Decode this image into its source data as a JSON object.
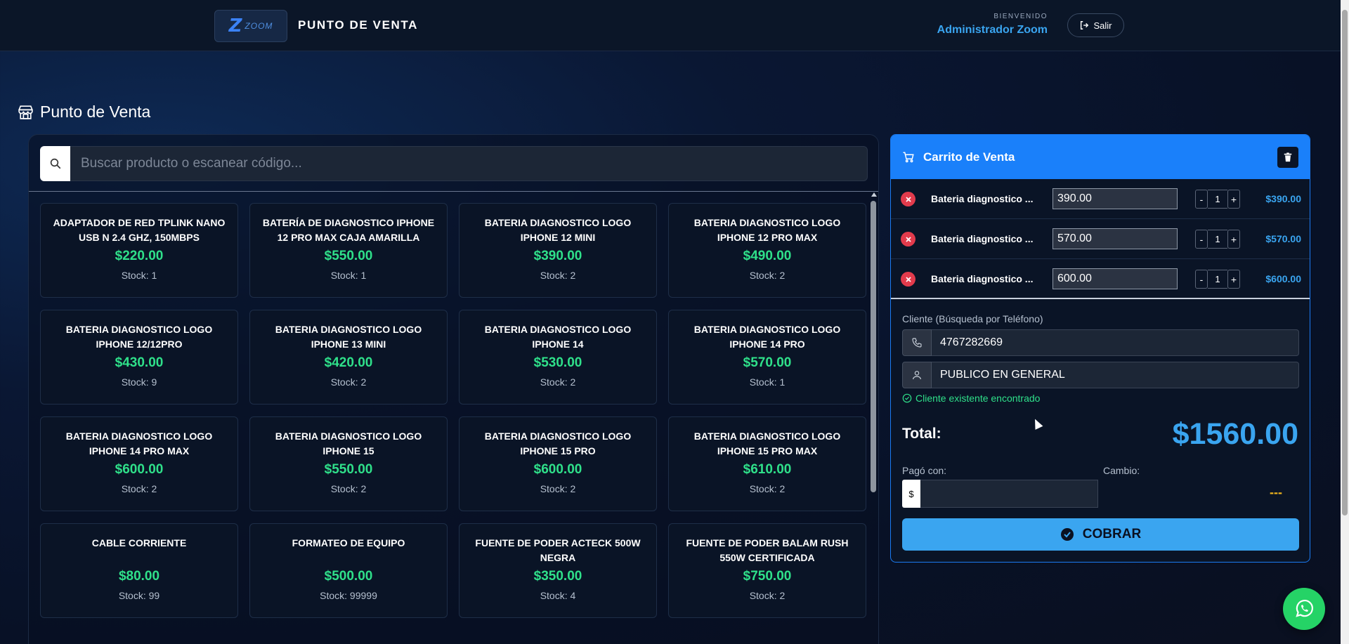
{
  "header": {
    "logo_text": "ZOOM",
    "app_title": "PUNTO DE VENTA",
    "welcome_label": "BIENVENIDO",
    "user_name": "Administrador Zoom",
    "logout_label": "Salir"
  },
  "page": {
    "title": "Punto de Venta"
  },
  "search": {
    "placeholder": "Buscar producto o escanear código..."
  },
  "products": [
    {
      "name": "ADAPTADOR DE RED TPLINK NANO USB N 2.4 GHZ, 150MBPS",
      "price": "$220.00",
      "stock": "Stock: 1"
    },
    {
      "name": "BATERÍA DE DIAGNOSTICO IPHONE 12 PRO MAX CAJA AMARILLA",
      "price": "$550.00",
      "stock": "Stock: 1"
    },
    {
      "name": "BATERIA DIAGNOSTICO LOGO IPHONE 12 MINI",
      "price": "$390.00",
      "stock": "Stock: 2"
    },
    {
      "name": "BATERIA DIAGNOSTICO LOGO IPHONE 12 PRO MAX",
      "price": "$490.00",
      "stock": "Stock: 2"
    },
    {
      "name": "BATERIA DIAGNOSTICO LOGO IPHONE 12/12PRO",
      "price": "$430.00",
      "stock": "Stock: 9"
    },
    {
      "name": "BATERIA DIAGNOSTICO LOGO IPHONE 13 MINI",
      "price": "$420.00",
      "stock": "Stock: 2"
    },
    {
      "name": "BATERIA DIAGNOSTICO LOGO IPHONE 14",
      "price": "$530.00",
      "stock": "Stock: 2"
    },
    {
      "name": "BATERIA DIAGNOSTICO LOGO IPHONE 14 PRO",
      "price": "$570.00",
      "stock": "Stock: 1"
    },
    {
      "name": "BATERIA DIAGNOSTICO LOGO IPHONE 14 PRO MAX",
      "price": "$600.00",
      "stock": "Stock: 2"
    },
    {
      "name": "BATERIA DIAGNOSTICO LOGO IPHONE 15",
      "price": "$550.00",
      "stock": "Stock: 2"
    },
    {
      "name": "BATERIA DIAGNOSTICO LOGO IPHONE 15 PRO",
      "price": "$600.00",
      "stock": "Stock: 2"
    },
    {
      "name": "BATERIA DIAGNOSTICO LOGO IPHONE 15 PRO MAX",
      "price": "$610.00",
      "stock": "Stock: 2"
    },
    {
      "name": "CABLE CORRIENTE",
      "price": "$80.00",
      "stock": "Stock: 99"
    },
    {
      "name": "FORMATEO DE EQUIPO",
      "price": "$500.00",
      "stock": "Stock: 99999"
    },
    {
      "name": "FUENTE DE PODER ACTECK 500W NEGRA",
      "price": "$350.00",
      "stock": "Stock: 4"
    },
    {
      "name": "FUENTE DE PODER BALAM RUSH 550W CERTIFICADA",
      "price": "$750.00",
      "stock": "Stock: 2"
    }
  ],
  "cart": {
    "title": "Carrito de Venta",
    "items": [
      {
        "name": "Bateria diagnostico ...",
        "price": "390.00",
        "qty": "1",
        "total": "$390.00"
      },
      {
        "name": "Bateria diagnostico ...",
        "price": "570.00",
        "qty": "1",
        "total": "$570.00"
      },
      {
        "name": "Bateria diagnostico ...",
        "price": "600.00",
        "qty": "1",
        "total": "$600.00"
      }
    ],
    "client_label": "Cliente (Búsqueda por Teléfono)",
    "phone": "4767282669",
    "client_name": "PUBLICO EN GENERAL",
    "found_message": "Cliente existente encontrado",
    "total_label": "Total:",
    "total_value": "$1560.00",
    "paid_label": "Pagó con:",
    "paid_prefix": "$",
    "paid_value": "",
    "change_label": "Cambio:",
    "change_value": "---",
    "pay_button": "COBRAR"
  },
  "colors": {
    "accent": "#1a80fa",
    "price_green": "#2fe08a",
    "total_blue": "#3aa5f0",
    "danger": "#e23b4c",
    "whatsapp": "#25d366"
  }
}
